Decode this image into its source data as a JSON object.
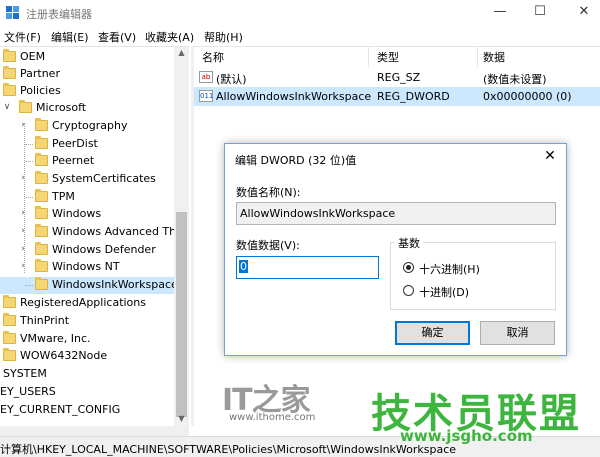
{
  "window": {
    "title": "注册表编辑器",
    "minimize": "—",
    "maximize": "☐",
    "close": "✕"
  },
  "menu": [
    "文件(F)",
    "编辑(E)",
    "查看(V)",
    "收藏夹(A)",
    "帮助(H)"
  ],
  "tree": {
    "items": [
      {
        "label": "OEM"
      },
      {
        "label": "Partner"
      },
      {
        "label": "Policies"
      },
      {
        "label": "Microsoft"
      },
      {
        "label": "Cryptography"
      },
      {
        "label": "PeerDist"
      },
      {
        "label": "Peernet"
      },
      {
        "label": "SystemCertificates"
      },
      {
        "label": "TPM"
      },
      {
        "label": "Windows"
      },
      {
        "label": "Windows Advanced Thr"
      },
      {
        "label": "Windows Defender"
      },
      {
        "label": "Windows NT"
      },
      {
        "label": "WindowsInkWorkspace"
      },
      {
        "label": "RegisteredApplications"
      },
      {
        "label": "ThinPrint"
      },
      {
        "label": "VMware, Inc."
      },
      {
        "label": "WOW6432Node"
      },
      {
        "label": "SYSTEM"
      },
      {
        "label": "EY_USERS"
      },
      {
        "label": "EY_CURRENT_CONFIG"
      }
    ]
  },
  "list": {
    "columns": [
      "名称",
      "类型",
      "数据"
    ],
    "rows": [
      {
        "name": "(默认)",
        "type": "REG_SZ",
        "data": "(数值未设置)",
        "icon": "ab"
      },
      {
        "name": "AllowWindowsInkWorkspace",
        "type": "REG_DWORD",
        "data": "0x00000000 (0)",
        "icon": "011"
      }
    ]
  },
  "status": "计算机\\HKEY_LOCAL_MACHINE\\SOFTWARE\\Policies\\Microsoft\\WindowsInkWorkspace",
  "dialog": {
    "title": "编辑 DWORD (32 位)值",
    "close": "✕",
    "name_label": "数值名称(N):",
    "name_value": "AllowWindowsInkWorkspace",
    "data_label": "数值数据(V):",
    "data_value": "0",
    "base_label": "基数",
    "radio_hex": "十六进制(H)",
    "radio_dec": "十进制(D)",
    "base_selected": "hex",
    "ok": "确定",
    "cancel": "取消"
  },
  "watermarks": {
    "it_logo": "IT之家",
    "it_url": "www.ithome.com",
    "site_logo": "技术员联盟",
    "site_url": "www.jsgho.com"
  }
}
